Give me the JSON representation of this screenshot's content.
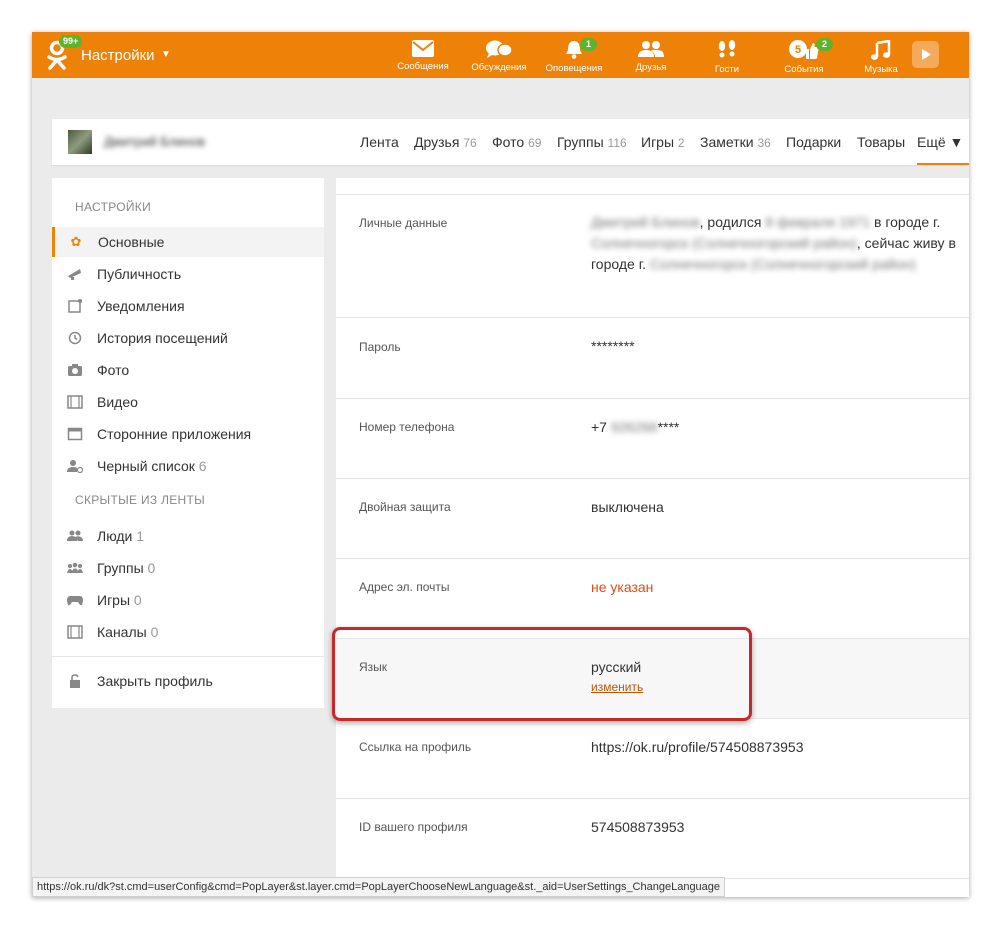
{
  "topbar": {
    "logo_badge": "99+",
    "title": "Настройки",
    "caret": "▼",
    "nav": [
      {
        "label": "Сообщения",
        "icon": "envelope-icon",
        "badge": ""
      },
      {
        "label": "Обсуждения",
        "icon": "chat-bubbles-icon",
        "badge": ""
      },
      {
        "label": "Оповещения",
        "icon": "bell-icon",
        "badge": "1"
      },
      {
        "label": "Друзья",
        "icon": "friends-icon",
        "badge": ""
      },
      {
        "label": "Гости",
        "icon": "footprints-icon",
        "badge": ""
      },
      {
        "label": "События",
        "icon": "like-icon",
        "badge": "2",
        "count": "5"
      },
      {
        "label": "Музыка",
        "icon": "music-note-icon",
        "badge": ""
      }
    ],
    "brand_color": "#ee8208",
    "badge_color": "#5fb32c"
  },
  "profile": {
    "name": "Дмитрий Блинов",
    "tabs": [
      {
        "label": "Лента",
        "count": ""
      },
      {
        "label": "Друзья",
        "count": "76"
      },
      {
        "label": "Фото",
        "count": "69"
      },
      {
        "label": "Группы",
        "count": "116"
      },
      {
        "label": "Игры",
        "count": "2"
      },
      {
        "label": "Заметки",
        "count": "36"
      },
      {
        "label": "Подарки",
        "count": ""
      },
      {
        "label": "Товары",
        "count": ""
      },
      {
        "label": "Ещё ▼",
        "count": ""
      }
    ]
  },
  "sidebar": {
    "heading": "НАСТРОЙКИ",
    "items": [
      {
        "label": "Основные",
        "count": "",
        "icon": "gear-icon"
      },
      {
        "label": "Публичность",
        "count": "",
        "icon": "megaphone-icon"
      },
      {
        "label": "Уведомления",
        "count": "",
        "icon": "notification-icon"
      },
      {
        "label": "История посещений",
        "count": "",
        "icon": "history-icon"
      },
      {
        "label": "Фото",
        "count": "",
        "icon": "camera-icon"
      },
      {
        "label": "Видео",
        "count": "",
        "icon": "film-icon"
      },
      {
        "label": "Сторонние приложения",
        "count": "",
        "icon": "window-icon"
      },
      {
        "label": "Черный список",
        "count": "6",
        "icon": "blocked-user-icon"
      }
    ],
    "hidden_heading": "СКРЫТЫЕ ИЗ ЛЕНТЫ",
    "hidden_items": [
      {
        "label": "Люди",
        "count": "1",
        "icon": "people-icon"
      },
      {
        "label": "Группы",
        "count": "0",
        "icon": "groups-icon"
      },
      {
        "label": "Игры",
        "count": "0",
        "icon": "gamepad-icon"
      },
      {
        "label": "Каналы",
        "count": "0",
        "icon": "film-icon"
      }
    ],
    "close_profile": "Закрыть профиль"
  },
  "settings": {
    "personal": {
      "label": "Личные данные",
      "value_a": "Дмитрий Блинов",
      "value_b": ", родился",
      "value_c": "8 февраля 1971",
      "value_d": " в городе г.",
      "value_e": "Солнечногорск (Солнечногорский район)",
      "value_f": ", сейчас живу в городе г.",
      "value_g": "Солнечногорск (Солнечногорский район)"
    },
    "password": {
      "label": "Пароль",
      "value": "********"
    },
    "phone": {
      "label": "Номер телефона",
      "prefix": "+7",
      "masked": "926268",
      "suffix": "****"
    },
    "twofactor": {
      "label": "Двойная защита",
      "value": "выключена"
    },
    "email": {
      "label": "Адрес эл. почты",
      "value": "не указан"
    },
    "language": {
      "label": "Язык",
      "value": "русский",
      "action": "изменить"
    },
    "profile_link": {
      "label": "Ссылка на профиль",
      "value": "https://ok.ru/profile/574508873953"
    },
    "profile_id": {
      "label": "ID вашего профиля",
      "value": "574508873953"
    }
  },
  "statusbar": {
    "url": "https://ok.ru/dk?st.cmd=userConfig&cmd=PopLayer&st.layer.cmd=PopLayerChooseNewLanguage&st._aid=UserSettings_ChangeLanguage"
  }
}
